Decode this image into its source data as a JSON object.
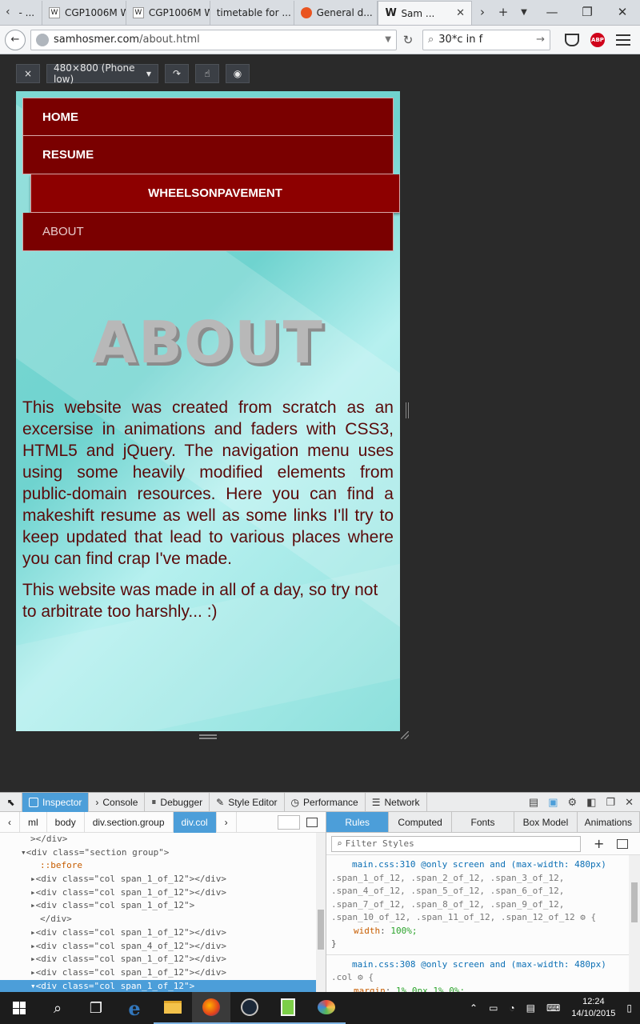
{
  "browser": {
    "tabs": [
      {
        "label": "- ...",
        "partial": true
      },
      {
        "label": "CGP1006M W...",
        "icon": "wiki-icon"
      },
      {
        "label": "CGP1006M W...",
        "icon": "wiki-icon"
      },
      {
        "label": "timetable for ...",
        "icon": "page-icon"
      },
      {
        "label": "General d...",
        "icon": "ubuntu-icon"
      },
      {
        "label": "Sam ...",
        "icon": "wiki-icon",
        "active": true
      }
    ],
    "url_host": "samhosmer.com",
    "url_path": "/about.html",
    "search_value": "30*c in f",
    "abp_label": "ABP"
  },
  "rdm": {
    "close_label": "×",
    "preset_label": "480×800 (Phone low)"
  },
  "site": {
    "nav": [
      {
        "label": "HOME",
        "state": "normal"
      },
      {
        "label": "RESUME",
        "state": "normal"
      },
      {
        "label": "WHEELSONPAVEMENT",
        "state": "hover"
      },
      {
        "label": "ABOUT",
        "state": "current"
      }
    ],
    "title": "ABOUT",
    "paragraph1": "This website was created from scratch as an excersise in animations and faders with CSS3, HTML5 and jQuery. The navigation menu uses using some heavily modified elements from public-domain resources. Here you can find a makeshift resume as well as some links I'll try to keep updated that lead to various places where you can find crap I've made.",
    "paragraph2": "This website was made in all of a day, so try not to arbitrate too harshly... :)"
  },
  "devtools": {
    "tabs": [
      "Inspector",
      "Console",
      "Debugger",
      "Style Editor",
      "Performance",
      "Network"
    ],
    "breadcrumbs": [
      "ml",
      "body",
      "div.section.group",
      "div.col"
    ],
    "markup": [
      {
        "text": "></div>",
        "indent": 2
      },
      {
        "text": "▾<div class=\"section group\">",
        "indent": 1
      },
      {
        "text": "::before",
        "indent": 3,
        "pseudo": true
      },
      {
        "text": "▸<div class=\"col span_1_of_12\"></div>",
        "indent": 2
      },
      {
        "text": "▸<div class=\"col span_1_of_12\"></div>",
        "indent": 2
      },
      {
        "text": "▸<div class=\"col span_1_of_12\">",
        "indent": 2
      },
      {
        "text": "</div>",
        "indent": 3
      },
      {
        "text": "▸<div class=\"col span_1_of_12\"></div>",
        "indent": 2
      },
      {
        "text": "▸<div class=\"col span_4_of_12\"></div>",
        "indent": 2
      },
      {
        "text": "▸<div class=\"col span_1_of_12\"></div>",
        "indent": 2
      },
      {
        "text": "▸<div class=\"col span_1_of_12\"></div>",
        "indent": 2
      },
      {
        "text": "▾<div class=\"col span_1_of_12\">",
        "indent": 2,
        "selected": true
      }
    ],
    "sub_tabs": [
      "Rules",
      "Computed",
      "Fonts",
      "Box Model",
      "Animations"
    ],
    "filter_placeholder": "Filter Styles",
    "rule1_source": "main.css:310 @only screen and (max-width: 480px)",
    "rule1_selector_1": ".span_1_of_12, .span_2_of_12, .span_3_of_12,",
    "rule1_selector_2": ".span_4_of_12, .span_5_of_12, .span_6_of_12,",
    "rule1_selector_3": ".span_7_of_12, .span_8_of_12, .span_9_of_12,",
    "rule1_selector_4": ".span_10_of_12, .span_11_of_12, .span_12_of_12 ⚙ {",
    "rule1_prop": "width",
    "rule1_value": "100%;",
    "rule1_close": "}",
    "rule2_source": "main.css:308 @only screen and (max-width: 480px)",
    "rule2_selector": ".col ⚙ {",
    "rule2_prop": "margin",
    "rule2_value": "1% 0px 1% 0%;"
  },
  "taskbar": {
    "time": "12:24",
    "date": "14/10/2015"
  },
  "colors": {
    "nav_bg": "#7a0000",
    "nav_hover_bg": "#8d0000",
    "accent_blue": "#4c9ed9",
    "text_maroon": "#5a0a0a"
  }
}
